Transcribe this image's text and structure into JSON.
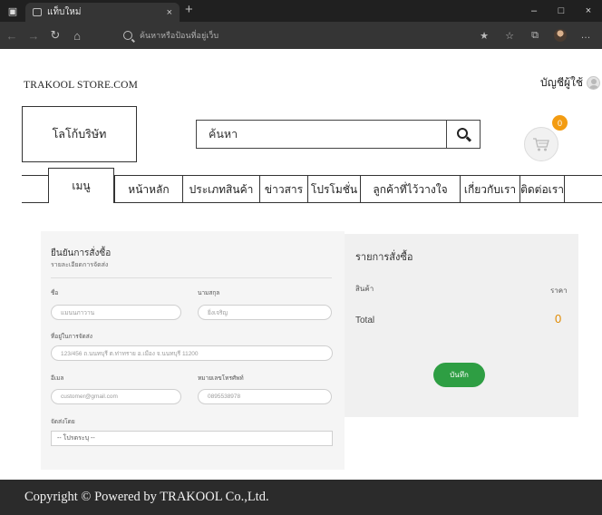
{
  "browser": {
    "tab_title": "แท็บใหม่",
    "tab_close": "×",
    "new_tab": "+",
    "address_placeholder": "ค้นหาหรือป้อนที่อยู่เว็บ",
    "window_controls": [
      "–",
      "□",
      "×"
    ],
    "more": "…"
  },
  "header": {
    "site_name": "TRAKOOL STORE.COM",
    "account_label": "บัญชีผู้ใช้",
    "logo_placeholder": "โลโก้บริษัท",
    "search_placeholder": "ค้นหา",
    "cart_count": "0"
  },
  "menu": {
    "items": [
      {
        "label": "เมนู"
      },
      {
        "label": "หน้าหลัก"
      },
      {
        "label": "ประเภทสินค้า"
      },
      {
        "label": "ข่าวสาร"
      },
      {
        "label": "โปรโมชั่น"
      },
      {
        "label": "ลูกค้าที่ไว้วางใจ"
      },
      {
        "label": "เกี่ยวกับเรา"
      },
      {
        "label": "ติดต่อเรา"
      }
    ]
  },
  "order_form": {
    "title": "ยืนยันการสั่งซื้อ",
    "subtitle": "รายละเอียดการจัดส่ง",
    "first_name_label": "ชื่อ",
    "first_name_value": "แมนนภาวาน",
    "last_name_label": "นามสกุล",
    "last_name_value": "ยิ่งเจริญ",
    "address_label": "ที่อยู่ในการจัดส่ง",
    "address_value": "123/456 ถ.นนทบุรี ต.ท่าทราย อ.เมือง จ.นนทบุรี 11200",
    "email_label": "อีเมล",
    "email_placeholder": "customer@gmail.com",
    "phone_label": "หมายเลขโทรศัพท์",
    "phone_placeholder": "0895538978",
    "payment_label": "จัดส่งโดย",
    "payment_selected": "-- โปรดระบุ --"
  },
  "summary": {
    "title": "รายการสั่งซื้อ",
    "product_col": "สินค้า",
    "price_col": "ราคา",
    "total_label": "Total",
    "total_value": "0",
    "save_label": "บันทึก"
  },
  "footer": {
    "copyright": "Copyright © Powered by TRAKOOL Co.,Ltd."
  },
  "colors": {
    "accent_green": "#2e9e43",
    "badge_orange": "#f39c12",
    "total_orange": "#e08a00",
    "footer_bg": "#2b2b2b",
    "browser_chrome": "#202020"
  }
}
